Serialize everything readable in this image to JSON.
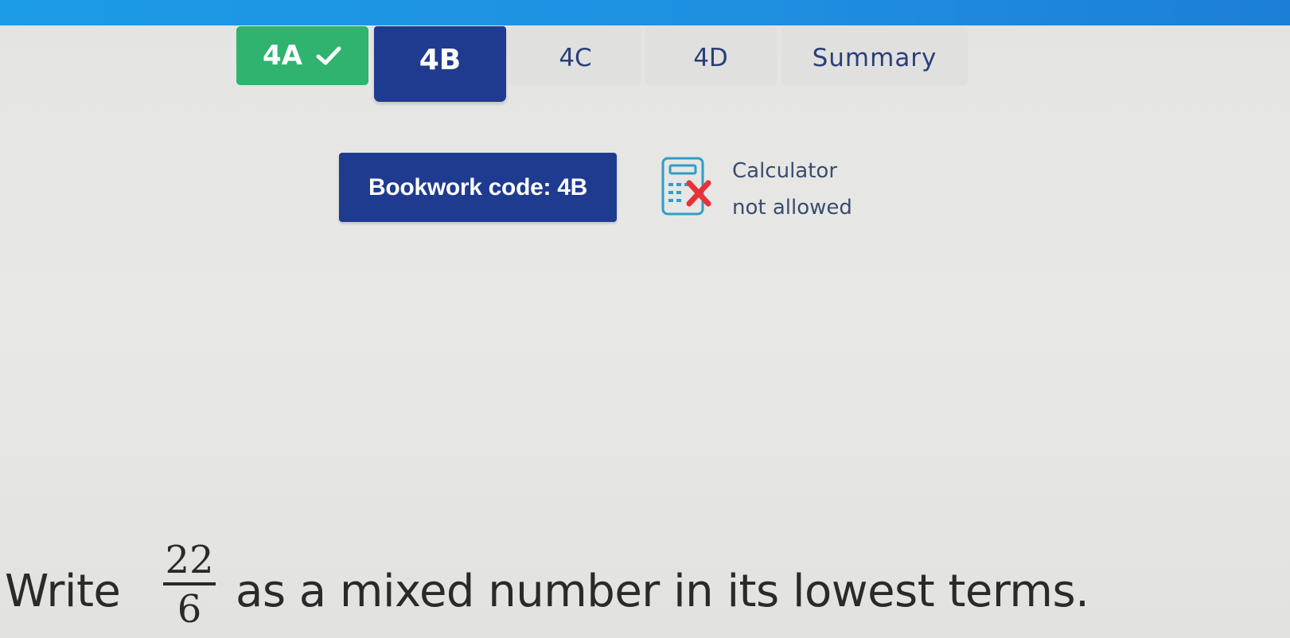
{
  "tabs": [
    {
      "label": "4A",
      "state": "completed"
    },
    {
      "label": "4B",
      "state": "active"
    },
    {
      "label": "4C",
      "state": "inactive"
    },
    {
      "label": "4D",
      "state": "inactive"
    },
    {
      "label": "Summary",
      "state": "inactive"
    }
  ],
  "bookwork": {
    "label": "Bookwork code: 4B"
  },
  "calculator": {
    "line1": "Calculator",
    "line2": "not allowed",
    "icon": "calculator-crossed-icon"
  },
  "question": {
    "prefix": "Write",
    "fraction": {
      "numerator": "22",
      "denominator": "6"
    },
    "suffix": "as a mixed number in its lowest terms."
  },
  "colors": {
    "top_bar": "#1c9be6",
    "completed_tab": "#2fb36f",
    "active_tab": "#1f3b8f",
    "inactive_tab_text": "#2a3f7a",
    "bookwork_bg": "#1f3b8f",
    "calc_icon_stroke": "#2f9ec4",
    "calc_cross": "#e8323a"
  }
}
